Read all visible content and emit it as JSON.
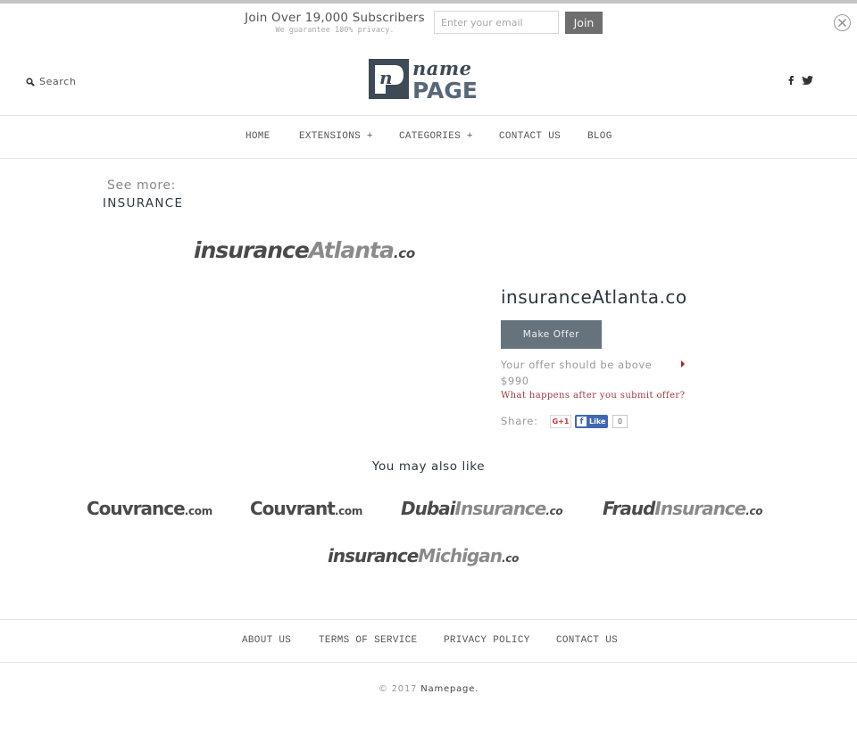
{
  "subscribe": {
    "title": "Join Over 19,000 Subscribers",
    "subtitle": "We guarantee 100% privacy.",
    "email_placeholder": "Enter your email",
    "join_label": "Join"
  },
  "header": {
    "search_label": "Search",
    "logo": {
      "top": "name",
      "bottom": "PAGE",
      "mark": "n"
    },
    "social": [
      "facebook",
      "twitter"
    ]
  },
  "nav": {
    "items": [
      {
        "label": "HOME"
      },
      {
        "label": "EXTENSIONS +"
      },
      {
        "label": "CATEGORIES +"
      },
      {
        "label": "CONTACT US"
      },
      {
        "label": "BLOG"
      }
    ]
  },
  "see_more": {
    "label": "See more:",
    "category": "INSURANCE"
  },
  "product": {
    "logo": {
      "part1": "insurance",
      "part2": "Atlanta",
      "tld": ".co"
    },
    "domain": "insuranceAtlanta.co",
    "offer_button": "Make Offer",
    "offer_min_text": "Your offer should be above",
    "offer_min_value": "$990",
    "offer_help": "What happens after you submit offer?",
    "share_label": "Share:",
    "gplus_label": "G+1",
    "fb_like_label": "Like",
    "fb_count": "0"
  },
  "related": {
    "title": "You may also like",
    "items": [
      {
        "part1": "Couvrance",
        "part2": "",
        "tld": ".com"
      },
      {
        "part1": "Couvrant",
        "part2": "",
        "tld": ".com"
      },
      {
        "part1": "Dubai",
        "part2": "Insurance",
        "tld": ".co"
      },
      {
        "part1": "Fraud",
        "part2": "Insurance",
        "tld": ".co"
      },
      {
        "part1": "insurance",
        "part2": "Michigan",
        "tld": ".co"
      }
    ]
  },
  "footer": {
    "items": [
      {
        "label": "ABOUT US"
      },
      {
        "label": "TERMS OF SERVICE"
      },
      {
        "label": "PRIVACY POLICY"
      },
      {
        "label": "CONTACT US"
      }
    ],
    "copyright_prefix": "© 2017",
    "brand": "Namepage."
  },
  "colors": {
    "accent_button": "#66727c",
    "join_button": "#6e6e6e",
    "help_link": "#a03a3a",
    "facebook": "#4267b2",
    "gplus": "#c5372c"
  }
}
